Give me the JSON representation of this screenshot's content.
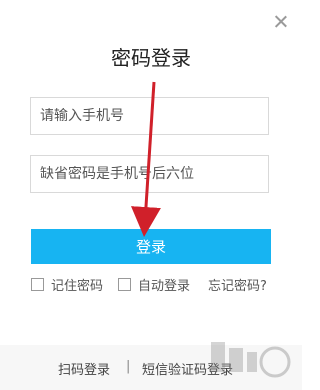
{
  "window": {
    "close_icon": "close-icon"
  },
  "title": "密码登录",
  "form": {
    "phone_placeholder": "请输入手机号",
    "password_placeholder": "缺省密码是手机号后六位",
    "login_label": "登录"
  },
  "options": {
    "remember_label": "记住密码",
    "auto_login_label": "自动登录",
    "forgot_label": "忘记密码?"
  },
  "footer": {
    "scan_label": "扫码登录",
    "separator": "|",
    "sms_label": "短信验证码登录"
  },
  "colors": {
    "accent": "#17b4f2",
    "annotation_arrow": "#d0202a"
  }
}
